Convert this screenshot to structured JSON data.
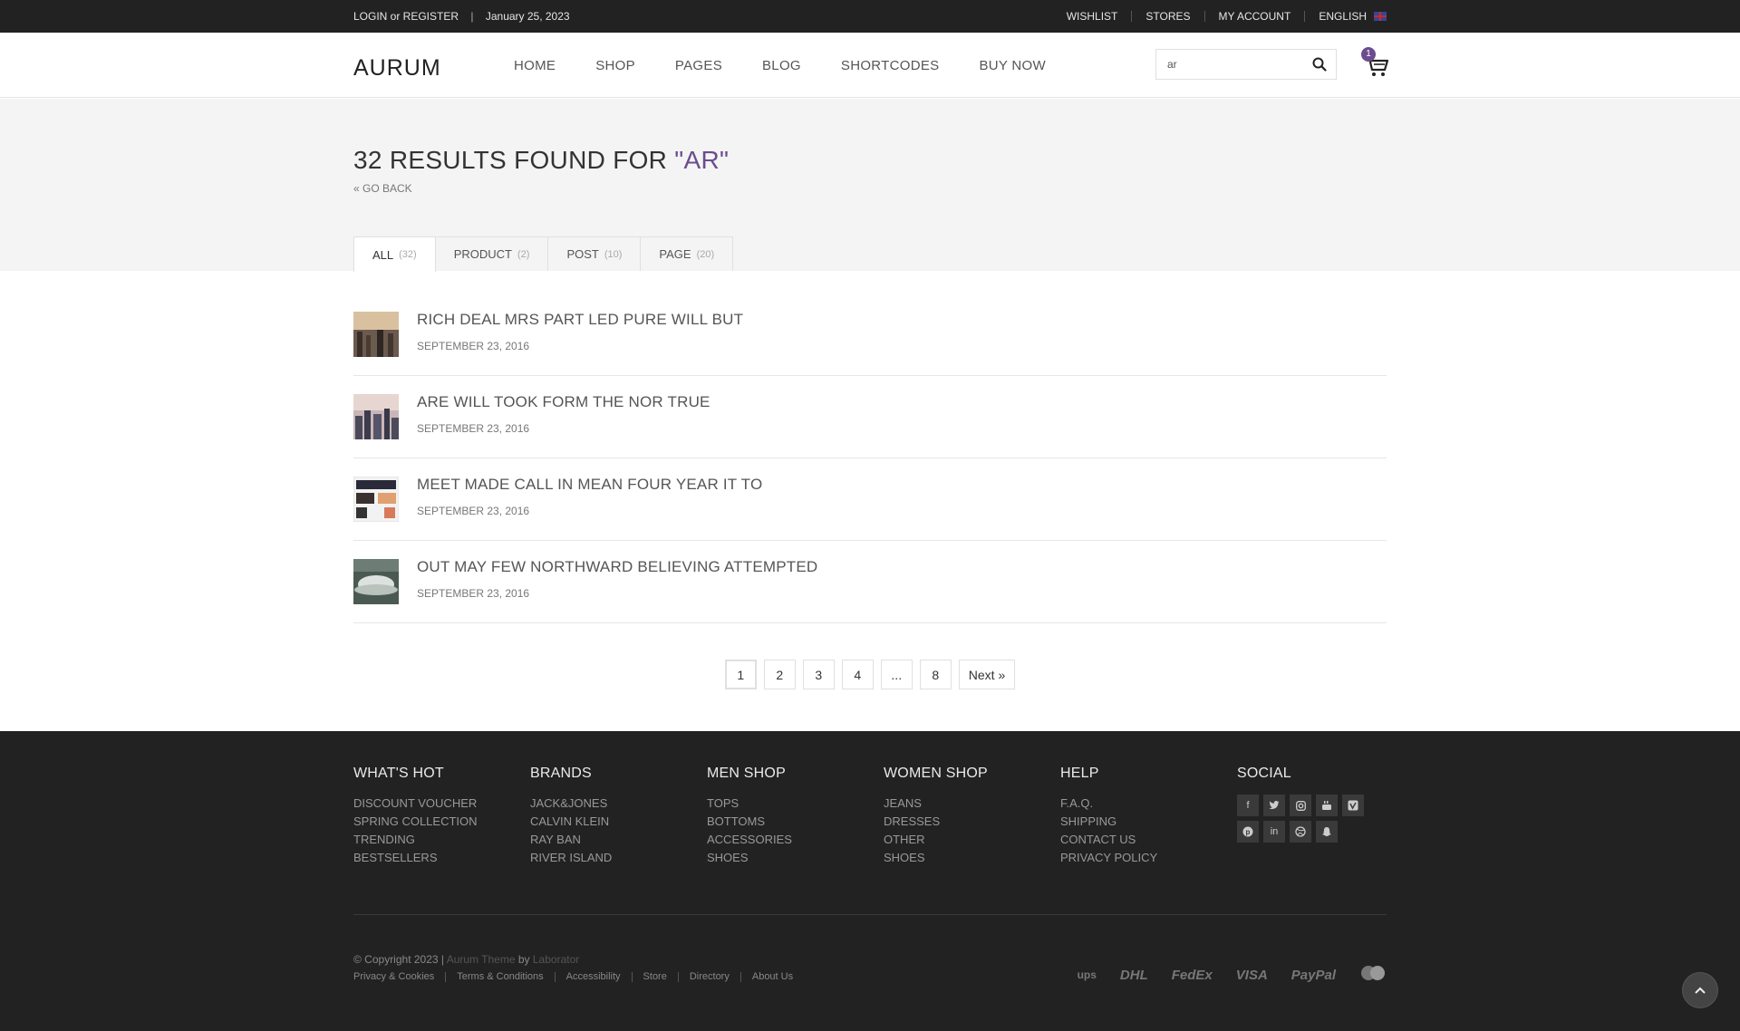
{
  "topbar": {
    "login_register": "LOGIN or REGISTER",
    "separator": "|",
    "date": "January 25, 2023",
    "links": [
      "WISHLIST",
      "STORES",
      "MY ACCOUNT"
    ],
    "language": "ENGLISH"
  },
  "header": {
    "logo": "AURUM",
    "nav": [
      "HOME",
      "SHOP",
      "PAGES",
      "BLOG",
      "SHORTCODES",
      "BUY NOW"
    ],
    "search_value": "ar",
    "cart_count": "1"
  },
  "results": {
    "title_prefix": "32 RESULTS FOUND FOR ",
    "query": "\"AR\"",
    "go_back": "« GO BACK",
    "tabs": [
      {
        "label": "ALL",
        "count": "(32)"
      },
      {
        "label": "PRODUCT",
        "count": "(2)"
      },
      {
        "label": "POST",
        "count": "(10)"
      },
      {
        "label": "PAGE",
        "count": "(20)"
      }
    ],
    "items": [
      {
        "title": "RICH DEAL MRS PART LED PURE WILL BUT",
        "date": "SEPTEMBER 23, 2016"
      },
      {
        "title": "ARE WILL TOOK FORM THE NOR TRUE",
        "date": "SEPTEMBER 23, 2016"
      },
      {
        "title": "MEET MADE CALL IN MEAN FOUR YEAR IT TO",
        "date": "SEPTEMBER 23, 2016"
      },
      {
        "title": "OUT MAY FEW NORTHWARD BELIEVING ATTEMPTED",
        "date": "SEPTEMBER 23, 2016"
      }
    ]
  },
  "pagination": {
    "pages": [
      "1",
      "2",
      "3",
      "4",
      "...",
      "8"
    ],
    "current": "1",
    "next": "Next »"
  },
  "footer": {
    "columns": [
      {
        "title": "WHAT'S HOT",
        "links": [
          "DISCOUNT VOUCHER",
          "SPRING COLLECTION",
          "TRENDING",
          "BESTSELLERS"
        ]
      },
      {
        "title": "BRANDS",
        "links": [
          "JACK&JONES",
          "CALVIN KLEIN",
          "RAY BAN",
          "RIVER ISLAND"
        ]
      },
      {
        "title": "MEN SHOP",
        "links": [
          "TOPS",
          "BOTTOMS",
          "ACCESSORIES",
          "SHOES"
        ]
      },
      {
        "title": "WOMEN SHOP",
        "links": [
          "JEANS",
          "DRESSES",
          "OTHER",
          "SHOES"
        ]
      },
      {
        "title": "HELP",
        "links": [
          "F.A.Q.",
          "SHIPPING",
          "CONTACT US",
          "PRIVACY POLICY"
        ]
      }
    ],
    "social_title": "SOCIAL",
    "social_icons": [
      "facebook-icon",
      "twitter-icon",
      "instagram-icon",
      "youtube-icon",
      "vimeo-icon",
      "pinterest-icon",
      "linkedin-icon",
      "dribbble-icon",
      "snapchat-icon"
    ],
    "copyright": "© Copyright 2023 |",
    "theme_link": "Aurum Theme",
    "by": "by",
    "author_link": "Laborator",
    "legal": [
      "Privacy & Cookies",
      "Terms & Conditions",
      "Accessibility",
      "Store",
      "Directory",
      "About Us"
    ],
    "payments": [
      "ups",
      "DHL",
      "FedEx",
      "VISA",
      "PayPal",
      "mastercard"
    ]
  }
}
